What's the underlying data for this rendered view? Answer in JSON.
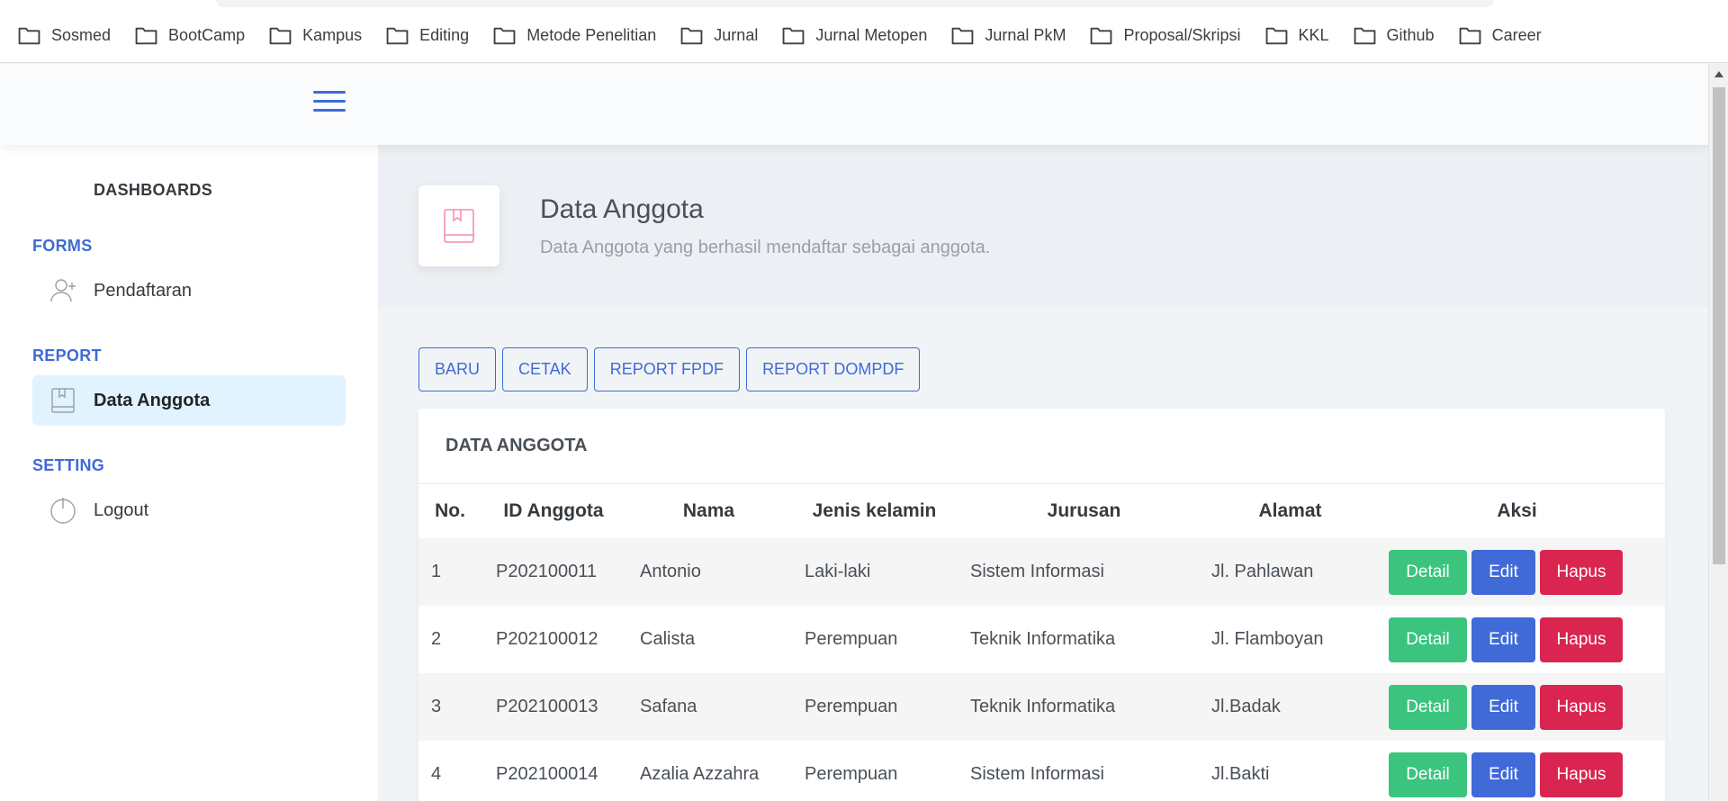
{
  "bookmarks": [
    "Sosmed",
    "BootCamp",
    "Kampus",
    "Editing",
    "Metode Penelitian",
    "Jurnal",
    "Jurnal Metopen",
    "Jurnal PkM",
    "Proposal/Skripsi",
    "KKL",
    "Github",
    "Career"
  ],
  "sidebar": {
    "dashboards": "DASHBOARDS",
    "forms_heading": "FORMS",
    "pendaftaran": "Pendaftaran",
    "report_heading": "REPORT",
    "data_anggota": "Data Anggota",
    "setting_heading": "SETTING",
    "logout": "Logout"
  },
  "page": {
    "title": "Data Anggota",
    "subtitle": "Data Anggota yang berhasil mendaftar sebagai anggota."
  },
  "actions": {
    "baru": "BARU",
    "cetak": "CETAK",
    "report_fpdf": "REPORT FPDF",
    "report_dompdf": "REPORT DOMPDF"
  },
  "table": {
    "title": "DATA ANGGOTA",
    "headers": [
      "No.",
      "ID Anggota",
      "Nama",
      "Jenis kelamin",
      "Jurusan",
      "Alamat",
      "Aksi"
    ],
    "rows": [
      {
        "no": "1",
        "id": "P202100011",
        "nama": "Antonio",
        "jk": "Laki-laki",
        "jurusan": "Sistem Informasi",
        "alamat": "Jl. Pahlawan"
      },
      {
        "no": "2",
        "id": "P202100012",
        "nama": "Calista",
        "jk": "Perempuan",
        "jurusan": "Teknik Informatika",
        "alamat": "Jl. Flamboyan"
      },
      {
        "no": "3",
        "id": "P202100013",
        "nama": "Safana",
        "jk": "Perempuan",
        "jurusan": "Teknik Informatika",
        "alamat": "Jl.Badak"
      },
      {
        "no": "4",
        "id": "P202100014",
        "nama": "Azalia Azzahra",
        "jk": "Perempuan",
        "jurusan": "Sistem Informasi",
        "alamat": "Jl.Bakti"
      }
    ],
    "buttons": {
      "detail": "Detail",
      "edit": "Edit",
      "hapus": "Hapus"
    }
  },
  "colors": {
    "primary": "#3f6ad8",
    "success": "#3ac47d",
    "danger": "#d92550",
    "active_bg": "#e0f3ff"
  },
  "icons": {
    "bookmark": "folder-icon",
    "menu": "hamburger-icon",
    "pendaftaran": "user-plus-icon",
    "data_anggota": "book-icon",
    "logout": "power-icon"
  }
}
